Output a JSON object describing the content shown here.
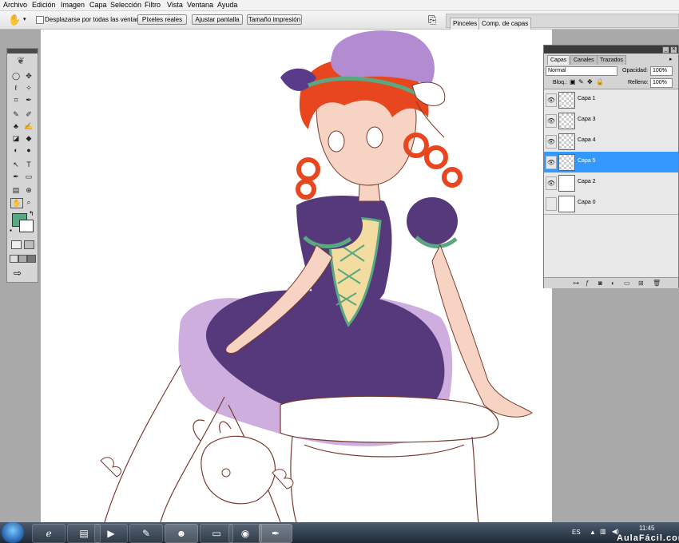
{
  "menu": [
    "Archivo",
    "Edición",
    "Imagen",
    "Capa",
    "Selección",
    "Filtro",
    "Vista",
    "Ventana",
    "Ayuda"
  ],
  "options": {
    "scroll_all_label": "Desplazarse por todas las ventanas",
    "actual_pixels": "Píxeles reales",
    "fit_screen": "Ajustar pantalla",
    "print_size": "Tamaño impresión"
  },
  "panel_well": {
    "tab1": "Pinceles",
    "tab2": "Comp. de capas"
  },
  "tools": {
    "row1": [
      "◯",
      "✥"
    ],
    "row2": [
      "ℓ",
      "✧"
    ],
    "row3": [
      "⌗",
      "✒"
    ],
    "row4": [
      "✎",
      "✐"
    ],
    "row5": [
      "♣",
      "✍"
    ],
    "row6": [
      "◪",
      "◆"
    ],
    "row7": [
      "◐",
      "●"
    ],
    "row8": [
      "↖",
      "T"
    ],
    "row9": [
      "✒",
      "▭"
    ],
    "row10": [
      "▤",
      "⊕"
    ],
    "row11": [
      "✋",
      "⌕"
    ],
    "fg_color": "#5aa882",
    "bg_color": "#ffffff"
  },
  "layers_panel": {
    "tabs": [
      "Capas",
      "Canales",
      "Trazados"
    ],
    "blend_mode": "Normal",
    "opacity_label": "Opacidad:",
    "opacity_value": "100%",
    "lock_label": "Bloq.:",
    "fill_label": "Relleno:",
    "fill_value": "100%",
    "layers": [
      "Capa 1",
      "Capa 3",
      "Capa 4",
      "Capa 5",
      "Capa 2",
      "Capa 0"
    ],
    "selected": "Capa 5",
    "selection_color": "#3399ff"
  },
  "taskbar": {
    "lang": "ES",
    "time": "11:45"
  },
  "watermark": "AulaFácil.com"
}
